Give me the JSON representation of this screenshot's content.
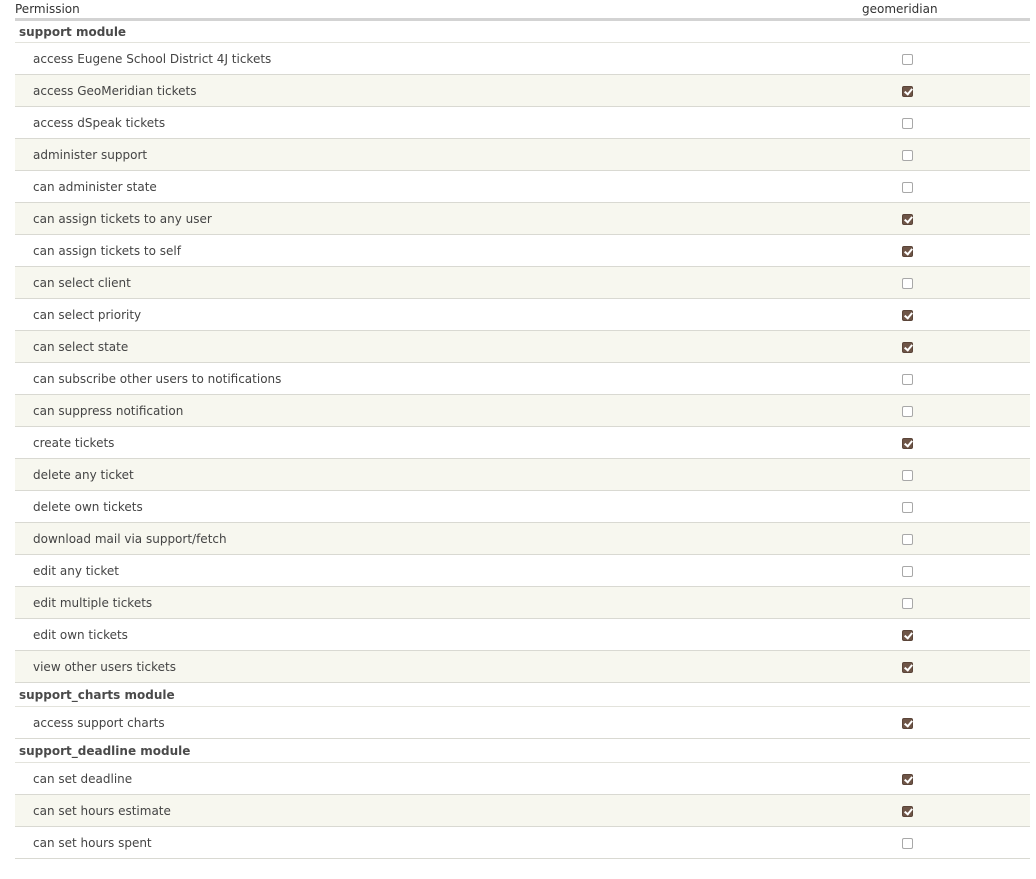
{
  "header": {
    "permission_label": "Permission",
    "role_label": "geomeridian"
  },
  "colors": {
    "checked_fill": "#6e5547",
    "row_stripe": "#f7f7ef",
    "header_rule": "#d3d3d3"
  },
  "modules": [
    {
      "title": "support module",
      "permissions": [
        {
          "label": "access Eugene School District 4J tickets",
          "checked": false
        },
        {
          "label": "access GeoMeridian tickets",
          "checked": true
        },
        {
          "label": "access dSpeak tickets",
          "checked": false
        },
        {
          "label": "administer support",
          "checked": false
        },
        {
          "label": "can administer state",
          "checked": false
        },
        {
          "label": "can assign tickets to any user",
          "checked": true
        },
        {
          "label": "can assign tickets to self",
          "checked": true
        },
        {
          "label": "can select client",
          "checked": false
        },
        {
          "label": "can select priority",
          "checked": true
        },
        {
          "label": "can select state",
          "checked": true
        },
        {
          "label": "can subscribe other users to notifications",
          "checked": false
        },
        {
          "label": "can suppress notification",
          "checked": false
        },
        {
          "label": "create tickets",
          "checked": true
        },
        {
          "label": "delete any ticket",
          "checked": false
        },
        {
          "label": "delete own tickets",
          "checked": false
        },
        {
          "label": "download mail via support/fetch",
          "checked": false
        },
        {
          "label": "edit any ticket",
          "checked": false
        },
        {
          "label": "edit multiple tickets",
          "checked": false
        },
        {
          "label": "edit own tickets",
          "checked": true
        },
        {
          "label": "view other users tickets",
          "checked": true
        }
      ]
    },
    {
      "title": "support_charts module",
      "permissions": [
        {
          "label": "access support charts",
          "checked": true
        }
      ]
    },
    {
      "title": "support_deadline module",
      "permissions": [
        {
          "label": "can set deadline",
          "checked": true
        },
        {
          "label": "can set hours estimate",
          "checked": true
        },
        {
          "label": "can set hours spent",
          "checked": false
        }
      ]
    }
  ]
}
